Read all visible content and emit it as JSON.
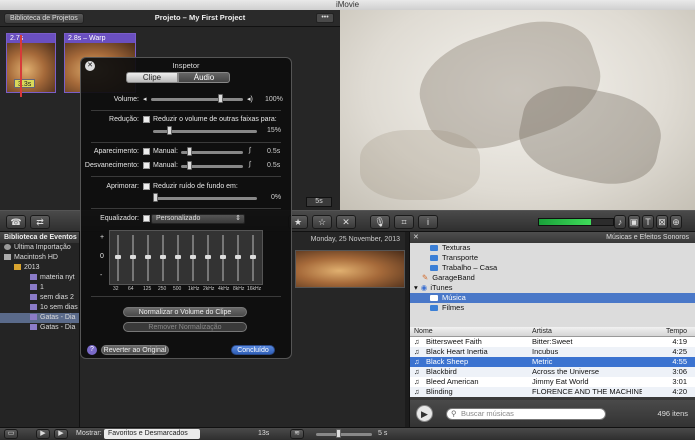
{
  "window": {
    "title": "iMovie"
  },
  "project": {
    "library_button": "Biblioteca de Projetos",
    "title": "Projeto – My First Project",
    "more_button": "•••",
    "clip1_duration": "2.7s",
    "clip2_duration": "2.8s – Warp",
    "clip_tag": "3.3s",
    "duration_readout": "5s"
  },
  "inspector": {
    "title": "Inspetor",
    "tabs": [
      "Clipe",
      "Áudio"
    ],
    "active_tab": "Áudio",
    "volume_label": "Volume:",
    "volume_value": "100%",
    "volume_level": 0.9,
    "reduction_label": "Redução:",
    "reduction_text": "Reduzir o volume de outras faixas para:",
    "reduction_value": "15%",
    "reduction_level": 0.15,
    "fade_in_label": "Aparecimento:",
    "fade_in_mode": "Manual:",
    "fade_in_value": "0.5s",
    "fade_out_label": "Desvanecimento:",
    "fade_out_mode": "Manual:",
    "fade_out_value": "0.5s",
    "enhance_label": "Aprimorar:",
    "enhance_text": "Reduzir ruído de fundo em:",
    "enhance_value": "0%",
    "equalizer_label": "Equalizador:",
    "equalizer_preset": "Personalizado",
    "eq_scale": [
      "+",
      "0",
      "-"
    ],
    "eq_bands": [
      "32",
      "64",
      "125",
      "250",
      "500",
      "1kHz",
      "2kHz",
      "4kHz",
      "8kHz",
      "16kHz"
    ],
    "normalize_button": "Normalizar o Volume do Clipe",
    "remove_normalize_button": "Remover Normalização",
    "revert_button": "Reverter ao Original",
    "done_button": "Concluído",
    "help_icon": "?"
  },
  "toolbar": {
    "mic_icon": "microphone-icon",
    "crop_icon": "crop-icon",
    "info_icon": "info-icon"
  },
  "events": {
    "header": "Biblioteca de Eventos",
    "items": [
      {
        "label": "Última Importação",
        "icon": "clock-icon"
      },
      {
        "label": "Macintosh HD",
        "icon": "disk-icon"
      },
      {
        "label": "2013",
        "icon": "folder-icon"
      },
      {
        "label": "materia nyt",
        "icon": "event-icon"
      },
      {
        "label": "1",
        "icon": "event-icon"
      },
      {
        "label": "sem dias 2",
        "icon": "event-icon"
      },
      {
        "label": "1o sem dias",
        "icon": "event-icon"
      },
      {
        "label": "Gatas - Dia",
        "icon": "event-icon"
      },
      {
        "label": "Gatas - Dia",
        "icon": "event-icon"
      }
    ],
    "date": "Monday, 25 November, 2013"
  },
  "music": {
    "header": "Músicas e Efeitos Sonoros",
    "sources": [
      {
        "label": "Texturas",
        "indent": 2
      },
      {
        "label": "Transporte",
        "indent": 2
      },
      {
        "label": "Trabalho – Casa",
        "indent": 2
      },
      {
        "label": "GarageBand",
        "indent": 1
      },
      {
        "label": "iTunes",
        "indent": 0
      },
      {
        "label": "Música",
        "indent": 1
      },
      {
        "label": "Filmes",
        "indent": 1
      }
    ],
    "selected_source": "Música",
    "columns": {
      "name": "Nome",
      "artist": "Artista",
      "time": "Tempo"
    },
    "tracks": [
      {
        "name": "Bittersweet Faith",
        "artist": "Bitter:Sweet",
        "time": "4:19"
      },
      {
        "name": "Black Heart Inertia",
        "artist": "Incubus",
        "time": "4:25"
      },
      {
        "name": "Black Sheep",
        "artist": "Metric",
        "time": "4:55"
      },
      {
        "name": "Blackbird",
        "artist": "Across the Universe",
        "time": "3:06"
      },
      {
        "name": "Bleed American",
        "artist": "Jimmy Eat World",
        "time": "3:01"
      },
      {
        "name": "Blinding",
        "artist": "FLORENCE AND THE MACHINE",
        "time": "4:20"
      }
    ],
    "selected_track": "Black Sheep",
    "search_placeholder": "Buscar músicas",
    "count": "496 itens"
  },
  "bottom": {
    "show_label": "Mostrar:",
    "show_value": "Favoritos e Desmarcados",
    "duration": "13s",
    "zoom": "5 s"
  },
  "colors": {
    "accent": "#3b73d0",
    "clip": "#6a4fc0",
    "playhead": "#d73a3a",
    "meter": "#3fdc5a"
  }
}
